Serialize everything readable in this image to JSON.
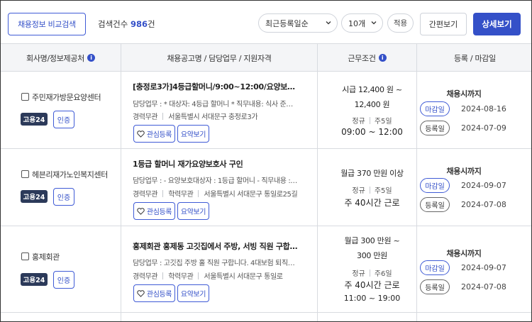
{
  "toolbar": {
    "compare_button": "채용정보 비교검색",
    "count_label": "검색건수",
    "count_value": "986",
    "count_unit": "건",
    "sort_select": "최근등록일순",
    "size_select": "10개",
    "apply_button": "적용",
    "simple_view_button": "간편보기",
    "detail_view_button": "상세보기"
  },
  "table": {
    "headers": {
      "company": "회사명/정보제공처",
      "posting": "채용공고명 / 담당업무 / 지원자격",
      "conditions": "근무조건",
      "dates": "등록 / 마감일"
    },
    "fav_button": "관심등록",
    "summary_button": "요약보기",
    "deadline_pill": "마감일",
    "registered_pill": "등록일",
    "rows": [
      {
        "company": "주민재가방문요양센터",
        "source_badge": "고용24",
        "cert_badge": "인증",
        "title": "[충정로3가]4등급할머니/9:00~12:00/요양보호사 구인",
        "duty": "담당업무 : * 대상자: 4등급 할머니 * 직무내용: 식사 준비, 청소",
        "qual1": "경력무관",
        "qual2": "",
        "location": "서울특별시 서대문구 충정로3가",
        "pay_line1": "시급 12,400 원 ~",
        "pay_line2": "12,400 원",
        "type": "정규",
        "days": "주5일",
        "hours": "09:00 ~ 12:00",
        "until": "채용시까지",
        "deadline": "2024-08-16",
        "registered": "2024-07-09"
      },
      {
        "company": "헤븐리재가노인복지센터",
        "source_badge": "고용24",
        "cert_badge": "인증",
        "title": "1등급 할머니 재가요양보호사 구인",
        "duty": "담당업무 : - 요양보호대상자 : 1등급 할머니 - 직무내용 : 식사 보조",
        "qual1": "경력무관",
        "qual2": "학력무관",
        "location": "서울특별시 서대문구 통일로25길",
        "pay_line1": "월급 370 만원 이상",
        "pay_line2": "",
        "type": "정규",
        "days": "주5일",
        "hours": "주 40시간 근로",
        "until": "채용시까지",
        "deadline": "2024-09-07",
        "registered": "2024-07-08"
      },
      {
        "company": "홍제회관",
        "source_badge": "고용24",
        "cert_badge": "인증",
        "title": "홍제회관 홍제동 고깃집에서 주방, 서빙 직원 구합니다.",
        "duty": "담당업무 : 고깃집 주방 홀 직원 구합니다. 4대보험 퇴직금 있습니다",
        "qual1": "경력무관",
        "qual2": "학력무관",
        "location": "서울특별시 서대문구 통일로",
        "pay_line1": "월급 300 만원 ~",
        "pay_line2": "300 만원",
        "type": "정규",
        "days": "주6일",
        "hours": "주 40시간 근로",
        "hours2": "11:00 ~ 19:00",
        "until": "채용시까지",
        "deadline": "2024-09-07",
        "registered": "2024-07-08"
      }
    ]
  },
  "colors": {
    "accent": "#3450c8",
    "badge_dark": "#2c3a5a",
    "header_bg": "#f4f5f7"
  },
  "icons": [
    "chevron-down-icon",
    "info-icon",
    "heart-icon",
    "checkbox"
  ]
}
